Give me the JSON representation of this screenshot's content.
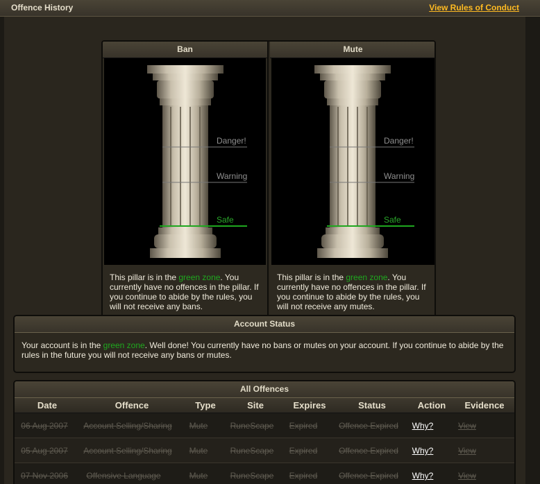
{
  "header": {
    "title": "Offence History",
    "rules_link": "View Rules of Conduct"
  },
  "pillars": [
    {
      "title": "Ban",
      "zones": {
        "danger": "Danger!",
        "warning": "Warning",
        "safe": "Safe"
      },
      "text_pre": "This pillar is in the ",
      "text_zone": "green zone",
      "text_post": ". You currently have no offences in the pillar. If you continue to abide by the rules, you will not receive any bans."
    },
    {
      "title": "Mute",
      "zones": {
        "danger": "Danger!",
        "warning": "Warning",
        "safe": "Safe"
      },
      "text_pre": "This pillar is in the ",
      "text_zone": "green zone",
      "text_post": ". You currently have no offences in the pillar. If you continue to abide by the rules, you will not receive any mutes."
    }
  ],
  "account_status": {
    "title": "Account Status",
    "text_pre": "Your account is in the ",
    "text_zone": "green zone",
    "text_post": ". Well done! You currently have no bans or mutes on your account. If you continue to abide by the rules in the future you will not receive any bans or mutes."
  },
  "offences": {
    "title": "All Offences",
    "columns": [
      "Date",
      "Offence",
      "Type",
      "Site",
      "Expires",
      "Status",
      "Action",
      "Evidence"
    ],
    "rows": [
      [
        "06 Aug 2007",
        "Account Selling/Sharing",
        "Mute",
        "RuneScape",
        "Expired",
        "Offence Expired",
        "Why?",
        "View"
      ],
      [
        "05 Aug 2007",
        "Account Selling/Sharing",
        "Mute",
        "RuneScape",
        "Expired",
        "Offence Expired",
        "Why?",
        "View"
      ],
      [
        "07 Nov 2006",
        "Offensive Language",
        "Mute",
        "RuneScape",
        "Expired",
        "Offence Expired",
        "Why?",
        "View"
      ]
    ]
  },
  "colors": {
    "zone_green": "#1fa81f",
    "link_gold": "#ffbb22"
  }
}
